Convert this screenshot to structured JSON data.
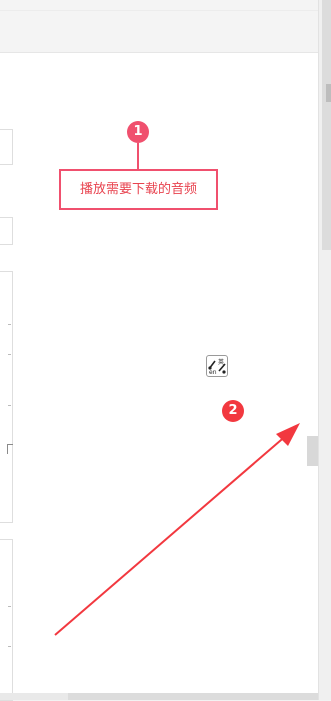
{
  "callouts": [
    {
      "number": "1",
      "text": "播放需要下载的音频"
    },
    {
      "number": "2"
    }
  ],
  "icons": {
    "translate": "translate-icon"
  },
  "colors": {
    "callout": "#f0506e",
    "arrow": "#f2383f"
  }
}
